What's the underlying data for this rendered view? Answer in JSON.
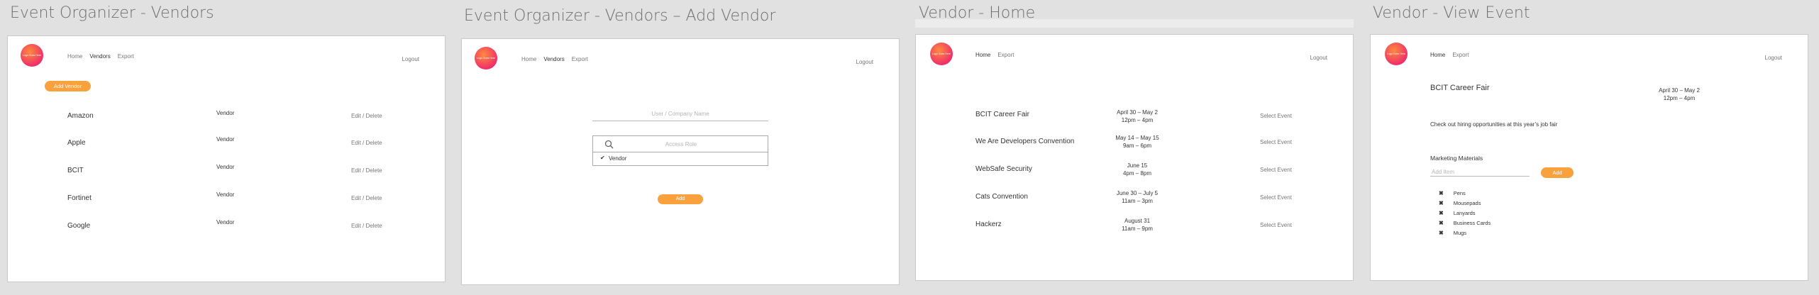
{
  "frames": [
    {
      "title": "Event Organizer - Vendors"
    },
    {
      "title": "Event Organizer - Vendors – Add Vendor"
    },
    {
      "title": "Vendor - Home"
    },
    {
      "title": "Vendor - View Event"
    }
  ],
  "brand": {
    "logo_text": "Logo Goes Here",
    "accent_color": "#f9a13c",
    "logo_gradient": [
      "#ff8a3d",
      "#d81b60"
    ]
  },
  "nav_organizer": {
    "home": "Home",
    "vendors": "Vendors",
    "export": "Export",
    "logout": "Logout"
  },
  "nav_vendor": {
    "home": "Home",
    "export": "Export",
    "logout": "Logout"
  },
  "vendors_list": {
    "add_button": "Add Vendor",
    "rows": [
      {
        "name": "Amazon",
        "role": "Vendor",
        "edit": "Edit",
        "sep": "/",
        "delete": "Delete"
      },
      {
        "name": "Apple",
        "role": "Vendor",
        "edit": "Edit",
        "sep": "/",
        "delete": "Delete"
      },
      {
        "name": "BCIT",
        "role": "Vendor",
        "edit": "Edit",
        "sep": "/",
        "delete": "Delete"
      },
      {
        "name": "Fortinet",
        "role": "Vendor",
        "edit": "Edit",
        "sep": "/",
        "delete": "Delete"
      },
      {
        "name": "Google",
        "role": "Vendor",
        "edit": "Edit",
        "sep": "/",
        "delete": "Delete"
      }
    ]
  },
  "add_vendor": {
    "name_placeholder": "User / Company Name",
    "role_placeholder": "Access Role",
    "role_option": "Vendor",
    "add_button": "Add"
  },
  "vendor_home": {
    "events": [
      {
        "name": "BCIT Career Fair",
        "dates": "April 30 – May 2",
        "times": "12pm – 4pm",
        "action": "Select Event"
      },
      {
        "name": "We Are Developers Convention",
        "dates": "May 14 – May 15",
        "times": "9am – 6pm",
        "action": "Select Event"
      },
      {
        "name": "WebSafe Security",
        "dates": "June 15",
        "times": "4pm – 8pm",
        "action": "Select Event"
      },
      {
        "name": "Cats Convention",
        "dates": "June 30 – July 5",
        "times": "11am – 3pm",
        "action": "Select Event"
      },
      {
        "name": "Hackerz",
        "dates": "August 31",
        "times": "11am – 9pm",
        "action": "Select Event"
      }
    ]
  },
  "view_event": {
    "title": "BCIT Career Fair",
    "dates": "April 30 – May 2",
    "times": "12pm – 4pm",
    "description": "Check out hiring opportunities at this year’s job fair",
    "materials_heading": "Marketing Materials",
    "item_placeholder": "Add Item",
    "add_button": "Add",
    "remove_glyph": "✖",
    "materials": [
      "Pens",
      "Mousepads",
      "Lanyards",
      "Business Cards",
      "Mugs"
    ]
  }
}
